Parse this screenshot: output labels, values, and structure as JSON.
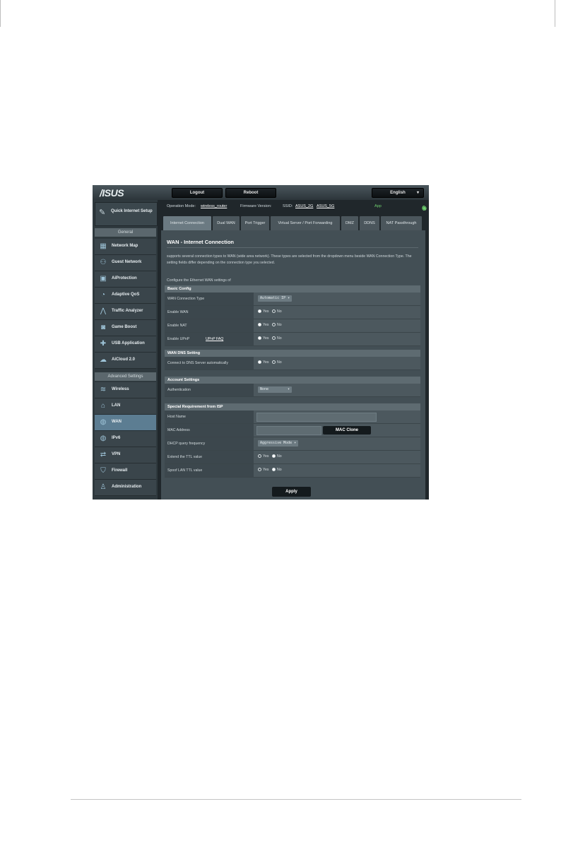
{
  "header": {
    "logo": "/ISUS",
    "logout": "Logout",
    "reboot": "Reboot",
    "language": "English"
  },
  "status": {
    "operation_mode_label": "Operation Mode:",
    "operation_mode_value": "wireless_router",
    "firmware_label": "Firmware Version:",
    "ssid_label": "SSID:",
    "ssid_1": "ASUS_2G",
    "ssid_2": "ASUS_5G",
    "app_label": "App"
  },
  "sidebar": {
    "quick_setup": "Quick Internet Setup",
    "general_header": "General",
    "advanced_header": "Advanced Settings",
    "general_items": [
      {
        "label": "Network Map",
        "icon": "network-map-icon"
      },
      {
        "label": "Guest Network",
        "icon": "guest-network-icon"
      },
      {
        "label": "AiProtection",
        "icon": "lock-icon"
      },
      {
        "label": "Adaptive QoS",
        "icon": "gauge-icon"
      },
      {
        "label": "Traffic Analyzer",
        "icon": "chart-icon"
      },
      {
        "label": "Game Boost",
        "icon": "gamepad-icon"
      },
      {
        "label": "USB Application",
        "icon": "puzzle-icon"
      },
      {
        "label": "AiCloud 2.0",
        "icon": "cloud-icon"
      }
    ],
    "advanced_items": [
      {
        "label": "Wireless",
        "icon": "wifi-icon"
      },
      {
        "label": "LAN",
        "icon": "home-icon"
      },
      {
        "label": "WAN",
        "icon": "globe-icon",
        "active": true
      },
      {
        "label": "IPv6",
        "icon": "globe-icon"
      },
      {
        "label": "VPN",
        "icon": "vpn-icon"
      },
      {
        "label": "Firewall",
        "icon": "shield-icon"
      },
      {
        "label": "Administration",
        "icon": "user-icon"
      }
    ]
  },
  "tabs": [
    "Internet Connection",
    "Dual WAN",
    "Port Trigger",
    "Virtual Server / Port Forwarding",
    "DMZ",
    "DDNS",
    "NAT Passthrough"
  ],
  "page": {
    "title": "WAN - Internet Connection",
    "description": "supports several connection types to WAN (wide area network). These types are selected from the dropdown menu beside WAN Connection Type. The setting fields differ depending on the connection type you selected.",
    "configure": "Configure the Ethernet WAN settings of"
  },
  "basic_config": {
    "header": "Basic Config",
    "wan_type_label": "WAN Connection Type",
    "wan_type_value": "Automatic IP",
    "enable_wan_label": "Enable WAN",
    "enable_nat_label": "Enable NAT",
    "enable_upnp_label": "Enable UPnP",
    "upnp_faq": "UPnP FAQ",
    "yes": "Yes",
    "no": "No"
  },
  "wan_dns": {
    "header": "WAN DNS Setting",
    "connect_dns_label": "Connect to DNS Server automatically"
  },
  "account": {
    "header": "Account Settings",
    "auth_label": "Authentication",
    "auth_value": "None"
  },
  "isp": {
    "header": "Special Requirement from ISP",
    "host_name_label": "Host Name",
    "mac_label": "MAC Address",
    "mac_clone": "MAC Clone",
    "dhcp_label": "DHCP query frequency",
    "dhcp_value": "Aggressive Mode",
    "extend_ttl_label": "Extend the TTL value",
    "spoof_ttl_label": "Spoof LAN TTL value"
  },
  "apply": "Apply"
}
